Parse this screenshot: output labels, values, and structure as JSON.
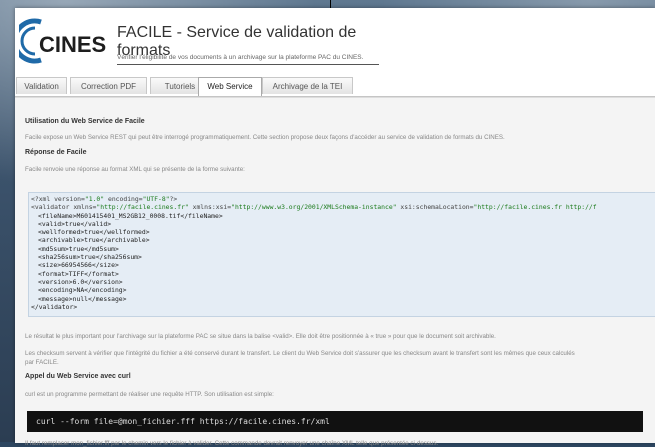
{
  "header": {
    "logo_text": "CINES",
    "title": "FACILE - Service de validation de formats",
    "subtitle": "Vérifier l'éligibilité de vos documents à un archivage sur la plateforme PAC du CINES."
  },
  "tabs": [
    {
      "label": "Validation"
    },
    {
      "label": "Correction PDF"
    },
    {
      "label": "Tutoriels"
    },
    {
      "label": "Web Service"
    },
    {
      "label": "Archivage de la TEI"
    }
  ],
  "content": {
    "heading1": "Utilisation du Web Service de Facile",
    "para1": "Facile expose un Web Service REST qui peut être interrogé programmatiquement. Cette section propose deux façons d'accéder au service de validation de formats du CINES.",
    "heading2": "Réponse de Facile",
    "para2": "Facile renvoie une réponse au format XML qui se présente de la forme suivante:",
    "xml": {
      "decl_open": "<?xml version=",
      "decl_version": "\"1.0\"",
      "decl_encoding_attr": " encoding=",
      "decl_encoding": "\"UTF-8\"",
      "decl_close": "?>",
      "root_open": "<validator xmlns=",
      "root_xmlns": "\"http://facile.cines.fr\"",
      "root_xsi_attr": " xmlns:xsi=",
      "root_xsi": "\"http://www.w3.org/2001/XMLSchema-instance\"",
      "root_loc_attr": " xsi:schemaLocation=",
      "root_loc": "\"http://facile.cines.fr http://f",
      "lines": [
        "<fileName>M601415401_MS2GB12_0008.tif</fileName>",
        "<valid>true</valid>",
        "<wellformed>true</wellformed>",
        "<archivable>true</archivable>",
        "<md5sum>true</md5sum>",
        "<sha256sum>true</sha256sum>",
        "<size>66954566</size>",
        "<format>TIFF</format>",
        "<version>6.0</version>",
        "<encoding>NA</encoding>",
        "<message>null</message>"
      ],
      "root_close": "</validator>"
    },
    "para3": "Le résultat le plus important pour l'archivage sur la plateforme PAC se situe dans la balise <valid>. Elle doit être positionnée à « true » pour que le document soit archivable.",
    "para4a": "Les checksum servent à vérifier que l'intégrité du fichier a été conservé durant le transfert. Le client du Web Service doit s'assurer que les checksum avant le transfert sont les mêmes que ceux calculés",
    "para4b": "par FACILE.",
    "heading3": "Appel du Web Service avec curl",
    "para5": "curl est un programme permettant de réaliser une requête HTTP. Son utilisation est simple:",
    "command": "curl --form file=@mon_fichier.fff https://facile.cines.fr/xml",
    "para6": "Il faut remplacer mon_fichier.fff par le chemin vers le fichier à valider. Cette commande devrait renvoyer une chaîne XML telle que présentée ci-dessus."
  },
  "colors": {
    "tab_active_bg": "#ffffff",
    "logo_blue": "#1f6aa8",
    "logo_text": "#1e1e1e",
    "code_bg": "#e5edf5",
    "command_bg": "#111111"
  }
}
